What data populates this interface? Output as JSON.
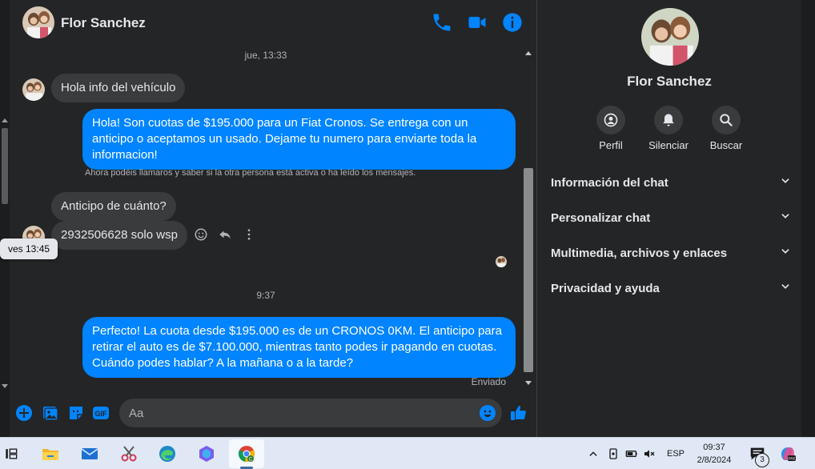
{
  "contact": {
    "name": "Flor Sanchez"
  },
  "header": {
    "call_icon": "phone-icon",
    "video_icon": "video-camera-icon",
    "info_icon": "info-icon"
  },
  "messages": {
    "ts1": "jue, 13:33",
    "m1": "Hola info del vehículo",
    "m2": "Hola! Son cuotas de $195.000 para un Fiat Cronos. Se entrega con un anticipo o aceptamos un usado. Dejame tu numero para enviarte toda la informacion!",
    "system": "Ahora podéis llamaros y saber si la otra persona está activa o ha leído los mensajes.",
    "m3": "Anticipo de cuánto?",
    "m4": "2932506628 solo wsp",
    "tooltip": "ves 13:45",
    "ts2": "9:37",
    "m5": "Perfecto! La cuota desde $195.000 es de un CRONOS 0KM. El anticipo para retirar el auto es de $7.100.000, mientras tanto podes ir pagando en cuotas. Cuándo podes hablar? A la mañana o a la tarde?",
    "status": "Enviado"
  },
  "composer": {
    "placeholder": "Aa"
  },
  "profile": {
    "actions": [
      {
        "label": "Perfil",
        "icon": "profile-icon"
      },
      {
        "label": "Silenciar",
        "icon": "bell-icon"
      },
      {
        "label": "Buscar",
        "icon": "search-icon"
      }
    ],
    "sections": [
      {
        "label": "Información del chat"
      },
      {
        "label": "Personalizar chat"
      },
      {
        "label": "Multimedia, archivos y enlaces"
      },
      {
        "label": "Privacidad y ayuda"
      }
    ]
  },
  "taskbar": {
    "lang": "ESP",
    "time": "09:37",
    "date": "2/8/2024",
    "notif_count": "3"
  },
  "colors": {
    "accent": "#0084ff",
    "panel": "#242526",
    "bubble_in": "#3a3b3c"
  }
}
